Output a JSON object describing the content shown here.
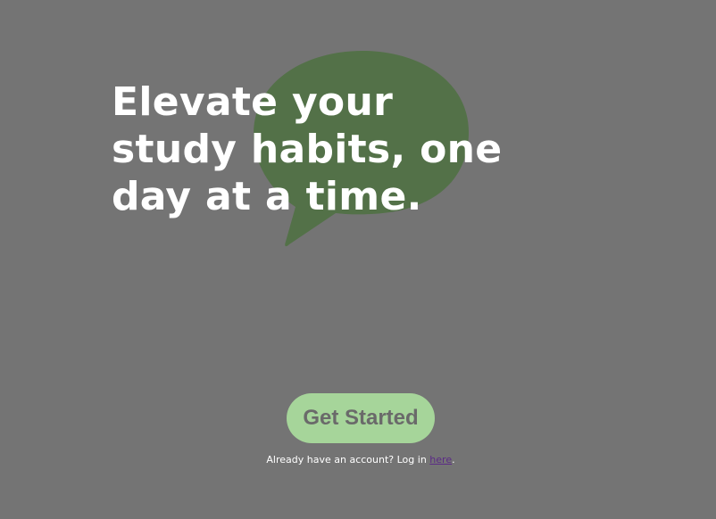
{
  "hero": {
    "title": "Elevate your study habits, one day at a time."
  },
  "cta": {
    "label": "Get Started"
  },
  "login": {
    "prefix": "Already have an account? Log in ",
    "link_text": "here",
    "suffix": "."
  },
  "colors": {
    "background": "#747474",
    "bubble": "#537148",
    "button": "#a6d59a",
    "button_text": "#6a6a6a",
    "link": "#5b2a86"
  },
  "icons": {
    "bubble": "speech-bubble-icon"
  }
}
